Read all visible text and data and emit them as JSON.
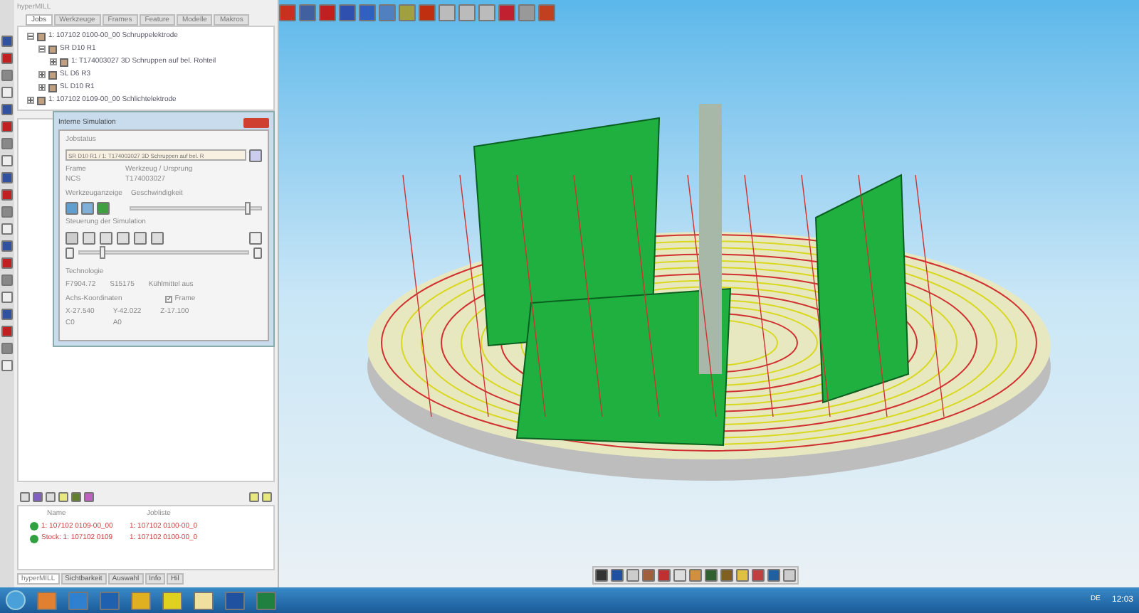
{
  "panel": {
    "title": "hyperMILL",
    "tabs": [
      {
        "label": "Jobs",
        "selected": true
      },
      {
        "label": "Werkzeuge",
        "selected": false
      },
      {
        "label": "Frames",
        "selected": false
      },
      {
        "label": "Feature",
        "selected": false
      },
      {
        "label": "Modelle",
        "selected": false
      },
      {
        "label": "Makros",
        "selected": false
      }
    ],
    "tree": [
      {
        "label": "1: 107102 0100-00_00 Schruppelektrode",
        "expanded": true,
        "children": [
          {
            "label": "SR D10 R1",
            "expanded": true,
            "children": [
              {
                "label": "1: T174003027 3D Schruppen auf bel. Rohteil",
                "expanded": false
              }
            ]
          },
          {
            "label": "SL D6 R3",
            "expanded": false
          },
          {
            "label": "SL D10 R1",
            "expanded": false
          }
        ]
      },
      {
        "label": "1: 107102 0109-00_00 Schlichtelektrode",
        "expanded": false
      }
    ],
    "list": {
      "columns": [
        "Name",
        "Jobliste"
      ],
      "rows": [
        [
          "1: 107102 0109-00_00",
          "1: 107102 0100-00_0"
        ],
        [
          "Stock: 1: 107102 0109",
          "1: 107102 0100-00_0"
        ]
      ]
    },
    "bottom_tabs": [
      {
        "label": "hyperMILL",
        "selected": true
      },
      {
        "label": "Sichtbarkeit",
        "selected": false
      },
      {
        "label": "Auswahl",
        "selected": false
      },
      {
        "label": "Info",
        "selected": false
      },
      {
        "label": "Hil",
        "selected": false
      }
    ]
  },
  "dialog": {
    "title": "Interne Simulation",
    "jobstatus_label": "Jobstatus",
    "jobstatus_value": "SR D10 R1 / 1: T174003027 3D Schruppen auf bel. R",
    "frame_label": "Frame",
    "frame_value": "NCS",
    "tool_label": "Werkzeug / Ursprung",
    "tool_value": "T174003027",
    "display_label": "Werkzeuganzeige",
    "speed_label": "Geschwindigkeit",
    "speed": {
      "level": 0.88
    },
    "control_label": "Steuerung der Simulation",
    "position": {
      "level": 0.12
    },
    "tech_label": "Technologie",
    "tech": [
      "F7904.72",
      "S15175",
      "Kühlmittel aus"
    ],
    "axes_label": "Achs-Koordinaten",
    "frame_check": {
      "label": "Frame",
      "checked": true
    },
    "coords": [
      "X-27.540",
      "Y-42.022",
      "Z-17.100",
      "C0",
      "A0"
    ]
  },
  "taskbar": {
    "language": "DE",
    "time": "12:03"
  }
}
